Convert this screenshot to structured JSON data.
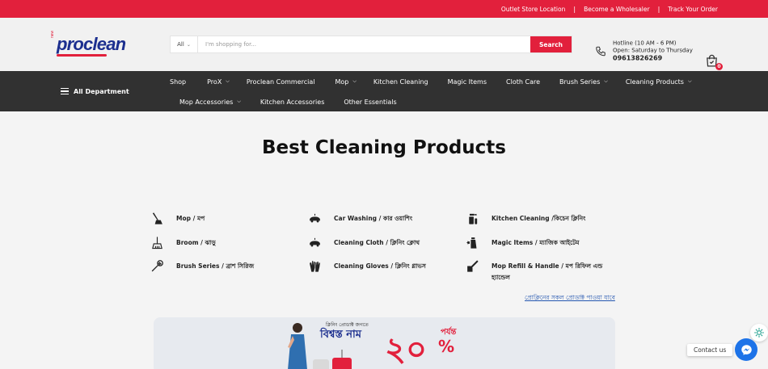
{
  "topbar": {
    "links": [
      "Outlet Store Location",
      "Become a Wholesaler",
      "Track Your Order"
    ],
    "separator": "|"
  },
  "header": {
    "logo": {
      "brand": "proclean",
      "tag": "new",
      "icon": "proclean-logo-icon"
    },
    "search": {
      "category": "All",
      "placeholder": "I'm shopping for...",
      "button": "Search"
    },
    "hotline": {
      "line1": "Hotline (10 AM - 6 PM)",
      "line2": "Open: Saturday to Thursday",
      "number": "09613826269"
    },
    "cart": {
      "count": "0",
      "icon": "shopping-bag-icon"
    }
  },
  "nav": {
    "all_department": "All Department",
    "row1": [
      {
        "label": "Shop",
        "dropdown": false
      },
      {
        "label": "ProX",
        "dropdown": true
      },
      {
        "label": "Proclean Commercial",
        "dropdown": false
      },
      {
        "label": "Mop",
        "dropdown": true
      },
      {
        "label": "Kitchen Cleaning",
        "dropdown": false
      },
      {
        "label": "Magic Items",
        "dropdown": false
      },
      {
        "label": "Cloth Care",
        "dropdown": false
      },
      {
        "label": "Brush Series",
        "dropdown": true
      },
      {
        "label": "Cleaning Products",
        "dropdown": true
      }
    ],
    "row2": [
      {
        "label": "Mop Accessories",
        "dropdown": true
      },
      {
        "label": "Kitchen Accessories",
        "dropdown": false
      },
      {
        "label": "Other Essentials",
        "dropdown": false
      }
    ]
  },
  "main": {
    "title": "Best Cleaning Products",
    "categories": [
      {
        "label": "Mop / মপ",
        "icon": "mop-icon"
      },
      {
        "label": "Broom / ঝাড়ু",
        "icon": "broom-icon"
      },
      {
        "label": "Brush Series / ব্রাশ সিরিজ",
        "icon": "brush-icon"
      },
      {
        "label": "Car Washing / কার ওয়াশিং",
        "icon": "car-wash-icon"
      },
      {
        "label": "Cleaning Cloth / ক্লিনিং ক্লোথ",
        "icon": "cleaning-cloth-icon"
      },
      {
        "label": "Cleaning Gloves / ক্লিনিং গ্লাভস",
        "icon": "gloves-icon"
      },
      {
        "label": "Kitchen Cleaning /কিচেন ক্লিনিং",
        "icon": "spray-bottle-icon"
      },
      {
        "label": "Magic Items / ম্যাজিক আইটেম",
        "icon": "magic-spray-icon"
      },
      {
        "label": "Mop Refill & Handle / মপ রিফিল এন্ড হ্যান্ডেল",
        "icon": "mop-refill-icon"
      }
    ],
    "more_link": "প্রোক্লিনের সকল প্রোডাক্ট পাওয়া যাবে",
    "banner": {
      "tagline_small": "ক্লিনিং প্রোডাক্ট জগতে",
      "tagline_big": "বিশ্বস্ত নাম",
      "offer_big": "২০",
      "offer_top": "পর্যন্ত",
      "offer_pct": "%"
    }
  },
  "floating": {
    "contact": "Contact us",
    "chat_icon": "messenger-icon",
    "ai_icon": "ai-assistant-icon"
  },
  "colors": {
    "brand_red": "#e2203c",
    "brand_blue": "#1c2f8f",
    "nav_bg": "#313131",
    "link_blue": "#2557b0"
  }
}
